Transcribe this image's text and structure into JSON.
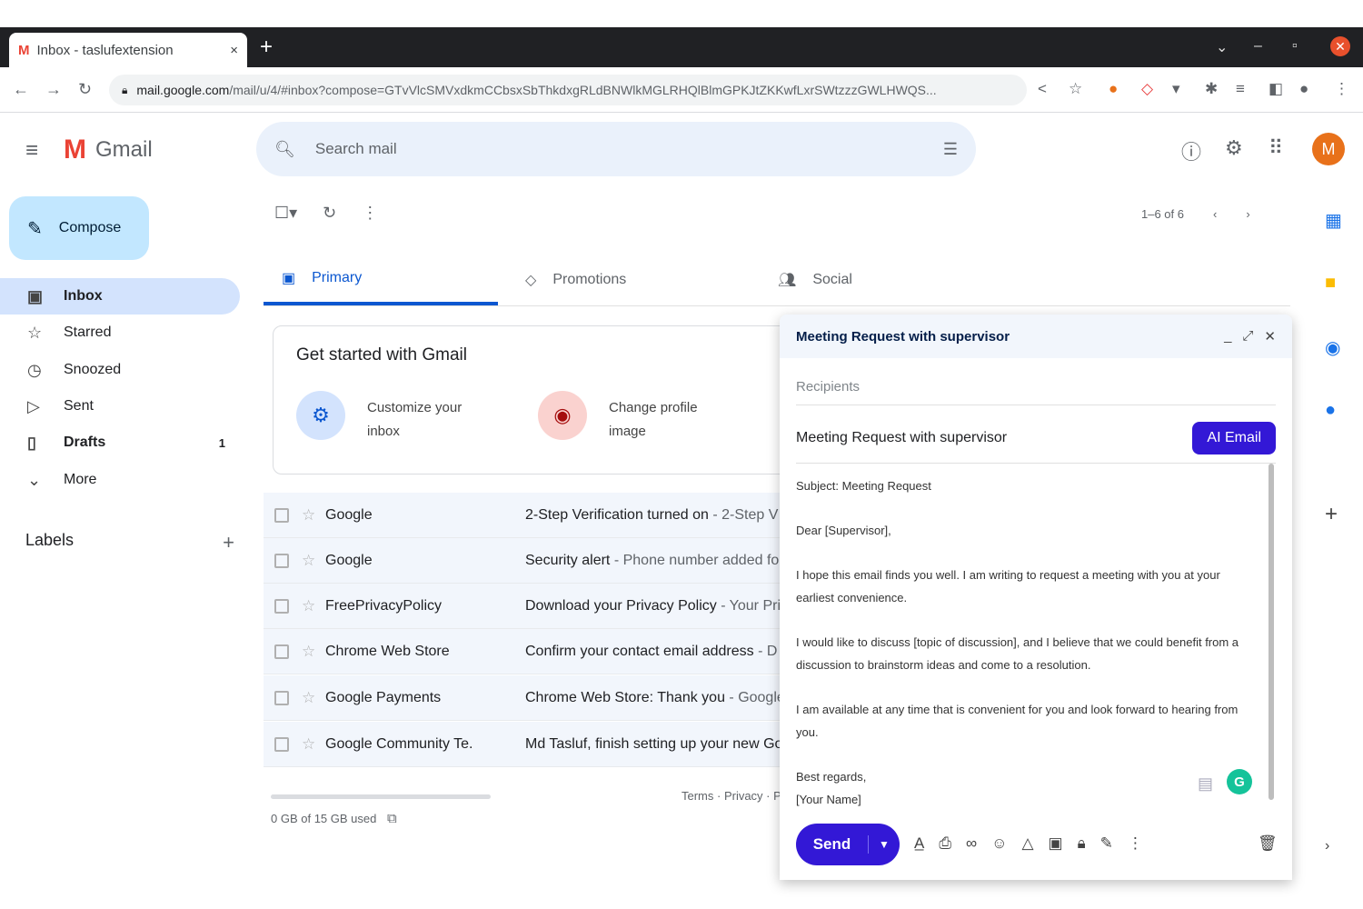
{
  "browser": {
    "tab_title": "Inbox - taslufextension",
    "tab_close": "×",
    "new_tab": "+",
    "url_host": "mail.google.com",
    "url_path": "/mail/u/4/#inbox?compose=GTvVlcSMVxdkmCCbsxSbThkdxgRLdBNWlkMGLRHQlBlmGPKJtZKKwfLxrSWtzzzGWLHWQS..."
  },
  "gmail": {
    "logo_text": "Gmail",
    "search_placeholder": "Search mail",
    "avatar_letter": "M",
    "compose_label": "Compose",
    "nav": [
      {
        "label": "Inbox",
        "count": ""
      },
      {
        "label": "Starred",
        "count": ""
      },
      {
        "label": "Snoozed",
        "count": ""
      },
      {
        "label": "Sent",
        "count": ""
      },
      {
        "label": "Drafts",
        "count": "1"
      },
      {
        "label": "More",
        "count": ""
      }
    ],
    "labels_title": "Labels",
    "labels_add": "+",
    "pager": "1–6 of 6",
    "tabs": [
      "Primary",
      "Promotions",
      "Social"
    ],
    "get_started": {
      "title": "Get started with Gmail",
      "item1": "Customize your inbox",
      "item2": "Change profile image"
    },
    "emails": [
      {
        "sender": "Google",
        "subject": "2-Step Verification turned on",
        "snippet": " - 2-Step V"
      },
      {
        "sender": "Google",
        "subject": "Security alert",
        "snippet": " - Phone number added fo"
      },
      {
        "sender": "FreePrivacyPolicy",
        "subject": "Download your Privacy Policy",
        "snippet": " - Your Pri"
      },
      {
        "sender": "Chrome Web Store",
        "subject": "Confirm your contact email address",
        "snippet": " - D"
      },
      {
        "sender": "Google Payments",
        "subject": "Chrome Web Store: Thank you",
        "snippet": " - Google"
      },
      {
        "sender": "Google Community Te.",
        "subject": "Md Tasluf, finish setting up your new Go",
        "snippet": ""
      }
    ],
    "storage": "0 GB of 15 GB used",
    "terms": "Terms · Privacy · P"
  },
  "compose": {
    "title": "Meeting Request with supervisor",
    "recipients_placeholder": "Recipients",
    "subject": "Meeting Request with supervisor",
    "ai_button": "AI Email",
    "body": {
      "p1": "Subject: Meeting Request",
      "p2": "Dear [Supervisor],",
      "p3": "I hope this email finds you well. I am writing to request a meeting with you at your earliest convenience.",
      "p4": "I would like to discuss [topic of discussion], and I believe that we could benefit from a discussion to brainstorm ideas and come to a resolution.",
      "p5": "I am available at any time that is convenient for you and look forward to hearing from you.",
      "p6a": "Best regards,",
      "p6b": "[Your Name]"
    },
    "send_label": "Send",
    "grammarly_letter": "G"
  },
  "colors": {
    "accent": "#3318d6",
    "selected_nav": "#d3e3fd",
    "primary_tab": "#0b57d0"
  }
}
